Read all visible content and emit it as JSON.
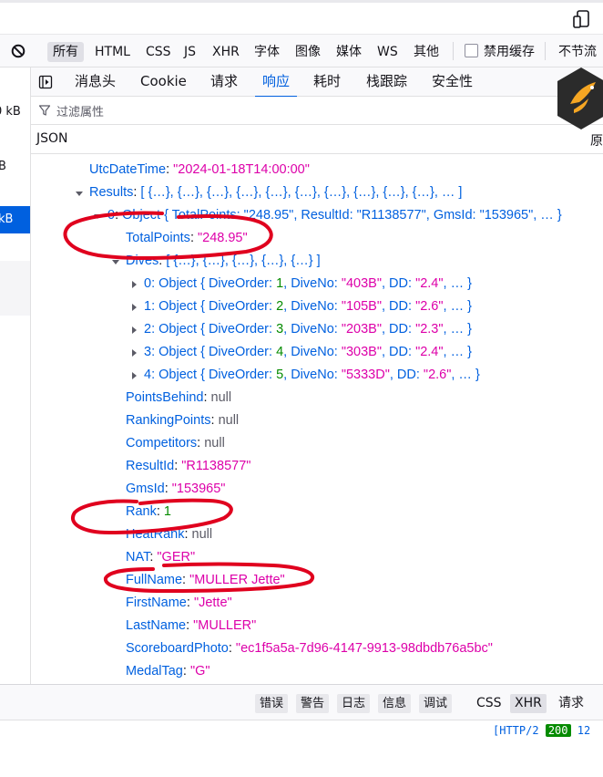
{
  "toolbar": {
    "filters": [
      "所有",
      "HTML",
      "CSS",
      "JS",
      "XHR",
      "字体",
      "图像",
      "媒体",
      "WS",
      "其他"
    ],
    "disable_cache": "禁用缓存",
    "throttle": "不节流"
  },
  "request_list": {
    "sizes": [
      "0 kB",
      "B",
      "kB"
    ]
  },
  "detail_tabs": [
    "消息头",
    "Cookie",
    "请求",
    "响应",
    "耗时",
    "栈跟踪",
    "安全性"
  ],
  "filter_placeholder": "过滤属性",
  "json_label": "JSON",
  "raw_label": "原",
  "tree": {
    "utc_key": "UtcDateTime",
    "utc_val": "\"2024-01-18T14:00:00\"",
    "results_key": "Results",
    "results_preview": "[ {…}, {…}, {…}, {…}, {…}, {…}, {…}, {…}, {…}, {…}, … ]",
    "item0_key": "0",
    "item0_preview": "Object { TotalPoints: \"248.95\", ResultId: \"R1138577\", GmsId: \"153965\", … }",
    "total_key": "TotalPoints",
    "total_val": "\"248.95\"",
    "dives_key": "Dives",
    "dives_preview": "[ {…}, {…}, {…}, {…}, {…} ]",
    "dives": [
      {
        "idx": "0",
        "order": "1",
        "no": "\"403B\"",
        "dd": "\"2.4\""
      },
      {
        "idx": "1",
        "order": "2",
        "no": "\"105B\"",
        "dd": "\"2.6\""
      },
      {
        "idx": "2",
        "order": "3",
        "no": "\"203B\"",
        "dd": "\"2.3\""
      },
      {
        "idx": "3",
        "order": "4",
        "no": "\"303B\"",
        "dd": "\"2.4\""
      },
      {
        "idx": "4",
        "order": "5",
        "no": "\"5333D\"",
        "dd": "\"2.6\""
      }
    ],
    "fields": {
      "points_behind": "null",
      "ranking_points": "null",
      "competitors": "null",
      "result_id": "\"R1138577\"",
      "gms_id": "\"153965\"",
      "rank": "1",
      "heat_rank": "null",
      "nat": "\"GER\"",
      "full_name": "\"MULLER Jette\"",
      "first_name": "\"Jette\"",
      "last_name": "\"MULLER\"",
      "scoreboard_photo": "\"ec1f5a5a-7d96-4147-9913-98dbdb76a5bc\"",
      "medal_tag": "\"G\""
    }
  },
  "console": {
    "levels": [
      "错误",
      "警告",
      "日志",
      "信息",
      "调试"
    ],
    "tabs": [
      "CSS",
      "XHR",
      "请求"
    ]
  },
  "status": {
    "protocol": "[HTTP/2",
    "code": "200",
    "extra": "12"
  },
  "colors": {
    "accent": "#0060df",
    "string": "#dd00a9",
    "number": "#058b00",
    "annotation": "#e0001e"
  }
}
